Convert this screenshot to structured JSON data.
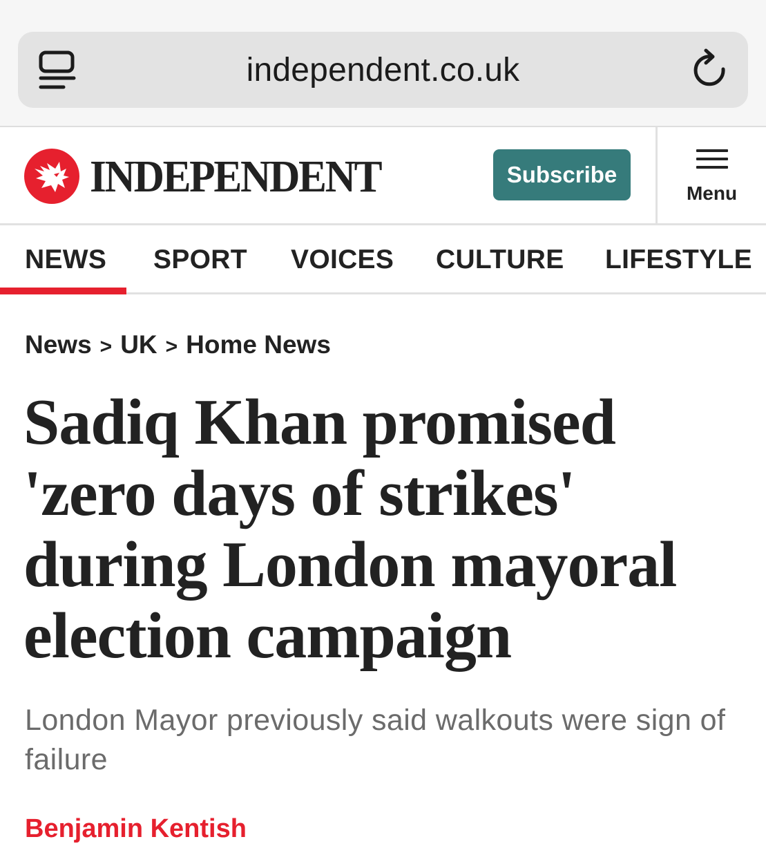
{
  "browser": {
    "url": "independent.co.uk",
    "icons": [
      "reader-view-icon",
      "reload-icon"
    ]
  },
  "masthead": {
    "logo_text": "INDEPENDENT",
    "logo_icon": "eagle-logo-icon",
    "subscribe_label": "Subscribe",
    "menu_label": "Menu",
    "brand_color": "#e6202e",
    "subscribe_color": "#367b7b"
  },
  "nav": {
    "items": [
      {
        "label": "NEWS",
        "active": true
      },
      {
        "label": "SPORT",
        "active": false
      },
      {
        "label": "VOICES",
        "active": false
      },
      {
        "label": "CULTURE",
        "active": false
      },
      {
        "label": "LIFESTYLE",
        "active": false
      }
    ]
  },
  "article": {
    "breadcrumb": [
      "News",
      "UK",
      "Home News"
    ],
    "breadcrumb_separator": ">",
    "headline": "Sadiq Khan promised 'zero days of strikes' during London mayoral election campaign",
    "standfirst": "London Mayor previously said walkouts were sign of failure",
    "byline": "Benjamin Kentish"
  }
}
